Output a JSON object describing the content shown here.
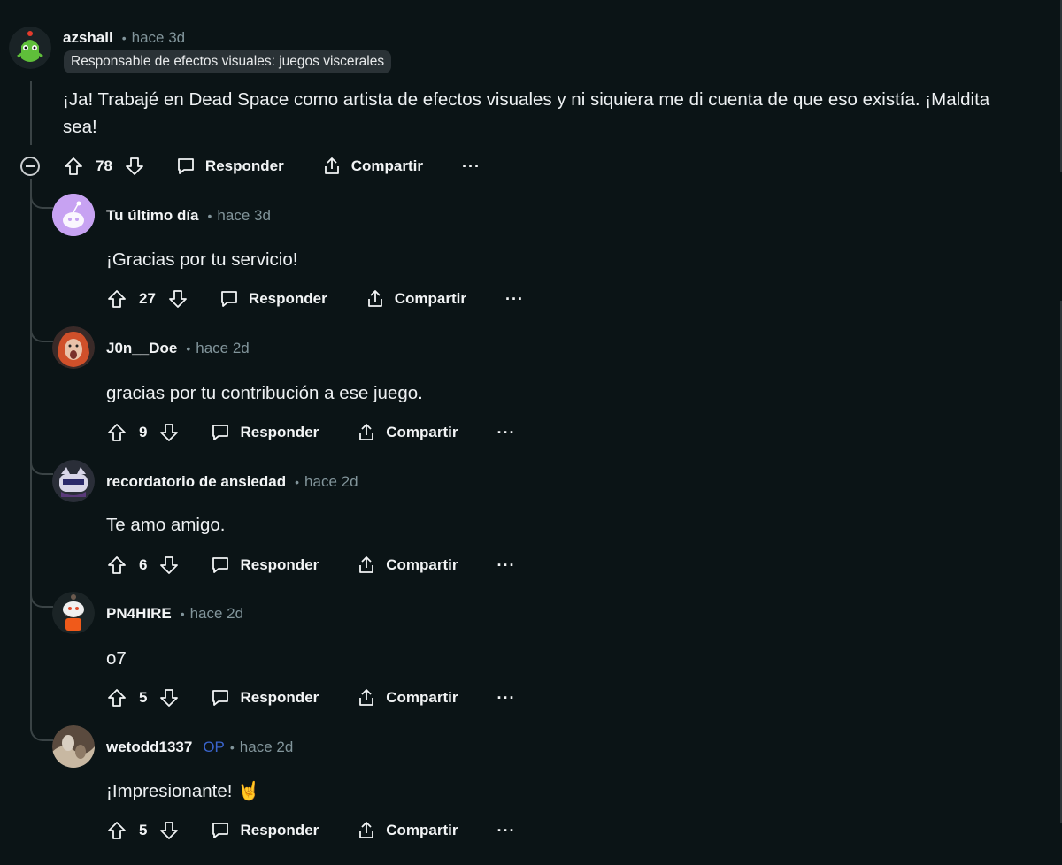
{
  "root_comment": {
    "author": "azshall",
    "time": "hace 3d",
    "flair": "Responsable de efectos visuales: juegos viscerales",
    "body": "¡Ja! Trabajé en Dead Space como artista de efectos visuales y ni siquiera me di cuenta de que eso existía. ¡Maldita sea!",
    "votes": "78",
    "reply_label": "Responder",
    "share_label": "Compartir",
    "more_label": "···",
    "avatar_icon": "green-alien-avatar-icon"
  },
  "replies": [
    {
      "author": "Tu último día",
      "time": "hace 3d",
      "op": "",
      "body": "¡Gracias por tu servicio!",
      "votes": "27",
      "reply_label": "Responder",
      "share_label": "Compartir",
      "more_label": "···",
      "avatar_icon": "purple-snoo-avatar-icon"
    },
    {
      "author": "J0n__Doe",
      "time": "hace 2d",
      "op": "",
      "body": "gracias por tu contribución a ese juego.",
      "votes": "9",
      "reply_label": "Responder",
      "share_label": "Compartir",
      "more_label": "···",
      "avatar_icon": "red-hair-avatar-icon"
    },
    {
      "author": "recordatorio de ansiedad",
      "time": "hace 2d",
      "op": "",
      "body": "Te amo amigo.",
      "votes": "6",
      "reply_label": "Responder",
      "share_label": "Compartir",
      "more_label": "···",
      "avatar_icon": "cat-avatar-icon"
    },
    {
      "author": "PN4HIRE",
      "time": "hace 2d",
      "op": "",
      "body": "o7",
      "votes": "5",
      "reply_label": "Responder",
      "share_label": "Compartir",
      "more_label": "···",
      "avatar_icon": "snoo-beard-avatar-icon"
    },
    {
      "author": "wetodd1337",
      "time": "hace 2d",
      "op": "OP",
      "body": "¡Impresionante! 🤘",
      "votes": "5",
      "reply_label": "Responder",
      "share_label": "Compartir",
      "more_label": "···",
      "avatar_icon": "photo-avatar-icon"
    }
  ],
  "colors": {
    "background": "#0b1416",
    "text": "#eef1f3",
    "muted": "#82959b",
    "op": "#3a64cc",
    "flair_bg": "#2a3236"
  }
}
